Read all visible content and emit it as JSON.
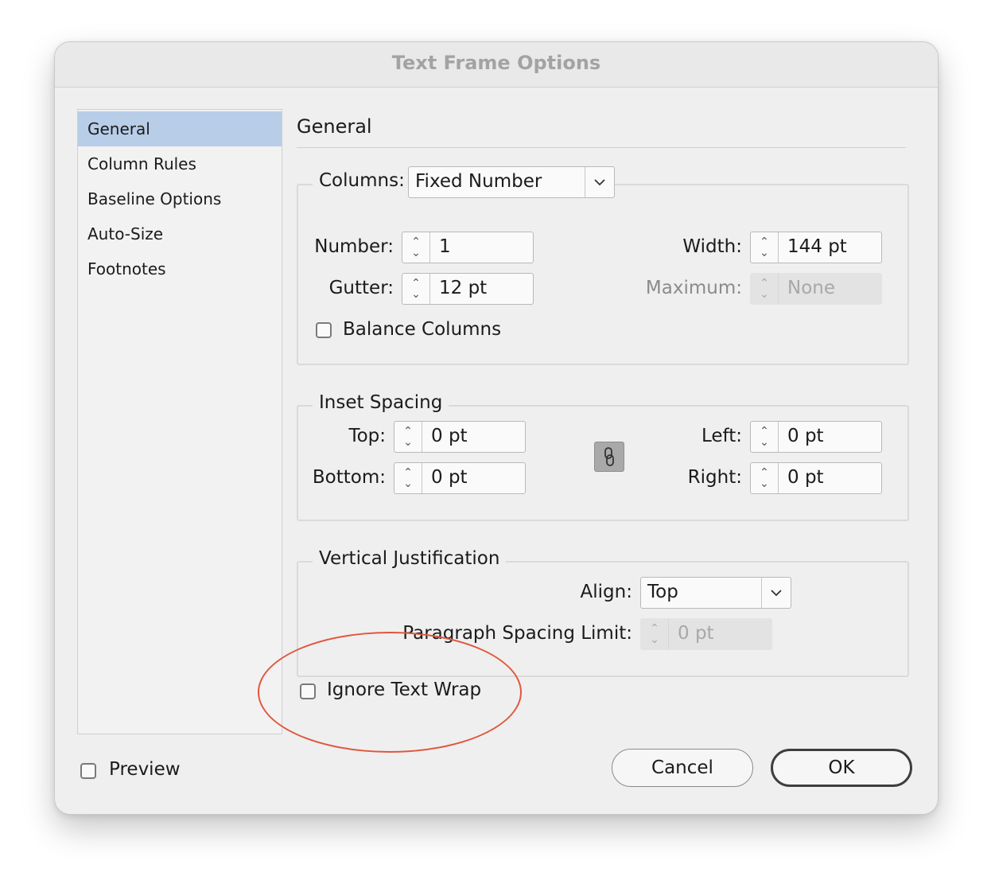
{
  "window": {
    "title": "Text Frame Options"
  },
  "sidebar": {
    "items": [
      {
        "label": "General",
        "selected": true
      },
      {
        "label": "Column Rules"
      },
      {
        "label": "Baseline Options"
      },
      {
        "label": "Auto-Size"
      },
      {
        "label": "Footnotes"
      }
    ]
  },
  "main": {
    "section_title": "General",
    "columns": {
      "label": "Columns:",
      "type_value": "Fixed Number",
      "number_label": "Number:",
      "number_value": "1",
      "gutter_label": "Gutter:",
      "gutter_value": "12 pt",
      "width_label": "Width:",
      "width_value": "144 pt",
      "maximum_label": "Maximum:",
      "maximum_value": "None",
      "balance_label": "Balance Columns",
      "balance_checked": false
    },
    "inset": {
      "legend": "Inset Spacing",
      "top_label": "Top:",
      "top_value": "0 pt",
      "bottom_label": "Bottom:",
      "bottom_value": "0 pt",
      "left_label": "Left:",
      "left_value": "0 pt",
      "right_label": "Right:",
      "right_value": "0 pt",
      "link_icon": "chain-link-icon"
    },
    "vertical": {
      "legend": "Vertical Justification",
      "align_label": "Align:",
      "align_value": "Top",
      "para_limit_label": "Paragraph Spacing Limit:",
      "para_limit_value": "0 pt"
    },
    "ignore_wrap_label": "Ignore Text Wrap",
    "ignore_wrap_checked": false
  },
  "footer": {
    "preview_label": "Preview",
    "preview_checked": false,
    "cancel_label": "Cancel",
    "ok_label": "OK"
  },
  "annotation": {
    "color": "#e0573e"
  }
}
